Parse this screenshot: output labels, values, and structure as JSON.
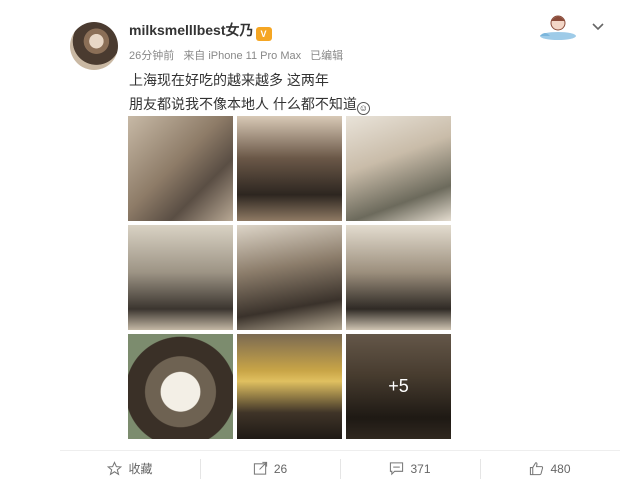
{
  "post": {
    "username": "milksmelllbest女乃",
    "badge": "V",
    "time": "26分钟前",
    "source": "来自 iPhone 11 Pro Max",
    "edited": "已编辑",
    "text_line1": "上海现在好吃的越来越多 这两年",
    "text_line2": "朋友都说我不像本地人 什么都不知道",
    "smile": "☺"
  },
  "gallery": {
    "more_label": "+5"
  },
  "actions": {
    "favorite_label": "收藏",
    "repost_count": "26",
    "comment_count": "371",
    "like_count": "480"
  }
}
